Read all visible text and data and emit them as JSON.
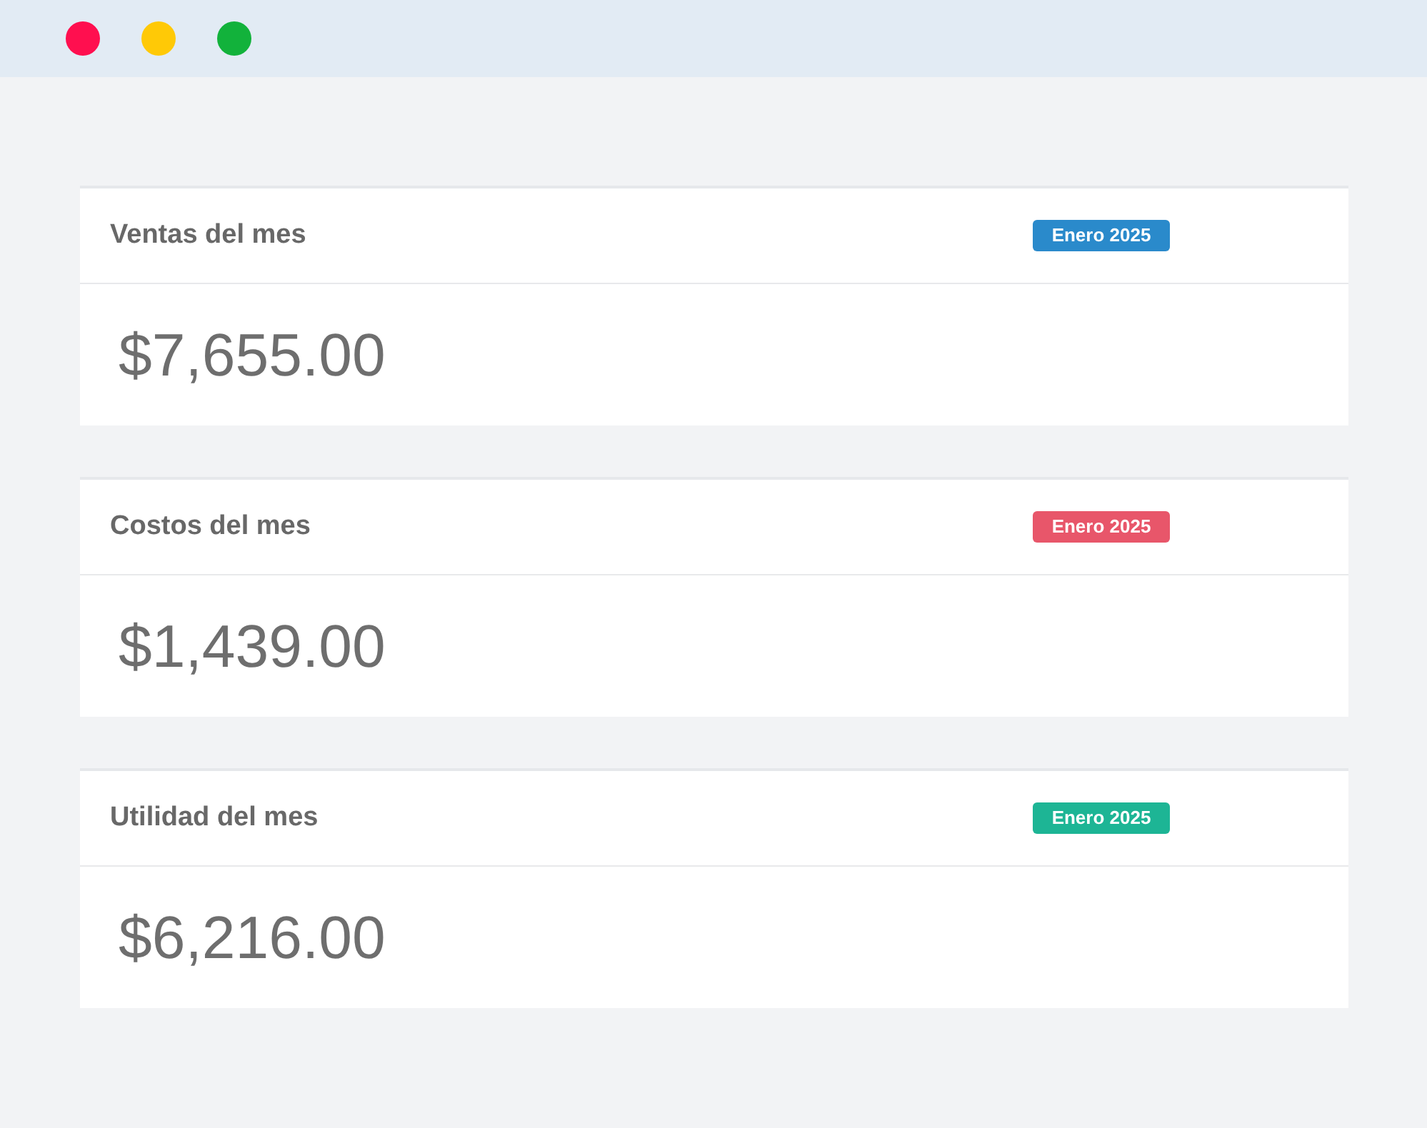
{
  "cards": [
    {
      "title": "Ventas del mes",
      "badge": {
        "text": "Enero 2025",
        "color": "#2a8acb"
      },
      "amount": "$7,655.00"
    },
    {
      "title": "Costos del mes",
      "badge": {
        "text": "Enero 2025",
        "color": "#e8566a"
      },
      "amount": "$1,439.00"
    },
    {
      "title": "Utilidad del mes",
      "badge": {
        "text": "Enero 2025",
        "color": "#1db595"
      },
      "amount": "$6,216.00"
    }
  ]
}
